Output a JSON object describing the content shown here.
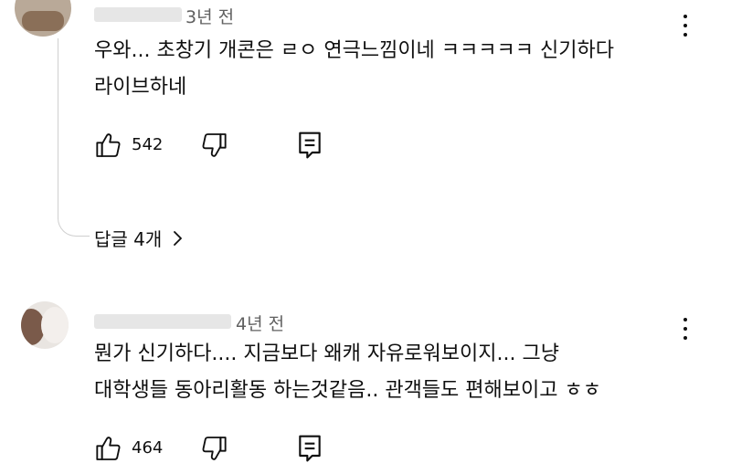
{
  "comments": [
    {
      "time": "3년 전",
      "lines": [
        "우와... 초창기 개콘은 ㄹㅇ 연극느낌이네 ㅋㅋㅋㅋㅋ 신기하다",
        "라이브하네"
      ],
      "likes": "542",
      "replies_label": "답글 4개"
    },
    {
      "time": "4년 전",
      "lines": [
        "뭔가 신기하다.... 지금보다 왜캐 자유로워보이지... 그냥",
        "대학생들 동아리활동 하는것같음.. 관객들도 편해보이고 ㅎㅎ"
      ],
      "likes": "464"
    }
  ],
  "icons": {
    "like": "thumbs-up-icon",
    "dislike": "thumbs-down-icon",
    "reply": "reply-icon",
    "more": "more-vert-icon",
    "chevron": "chevron-right-icon"
  },
  "colors": {
    "text": "#0f0f0f",
    "meta": "#606060",
    "thread": "#cfcfcf"
  }
}
